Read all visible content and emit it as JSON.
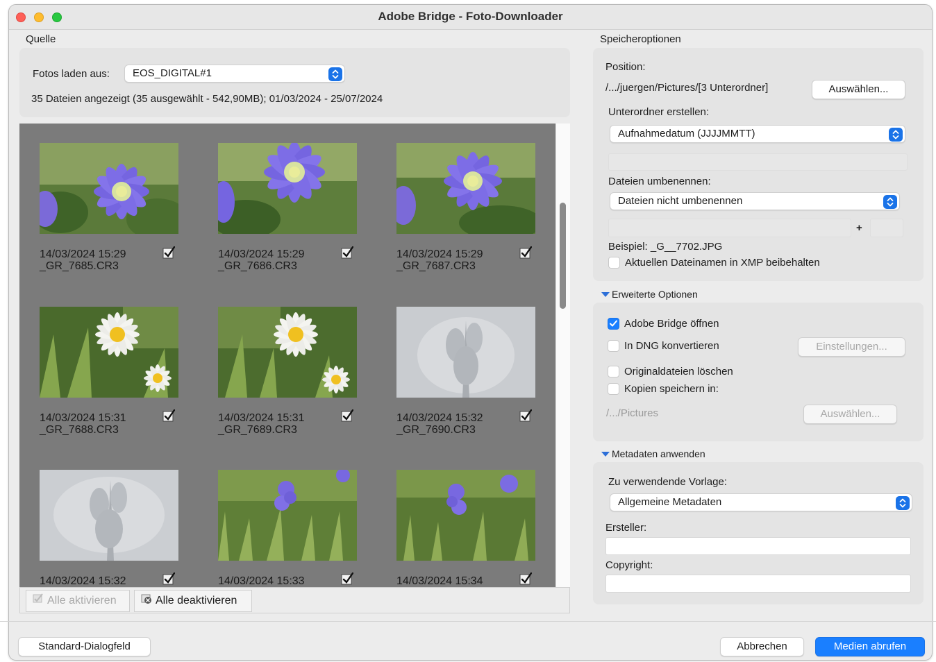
{
  "window": {
    "title": "Adobe Bridge - Foto-Downloader"
  },
  "source": {
    "section_label": "Quelle",
    "load_from_label": "Fotos laden aus:",
    "load_from_value": "EOS_DIGITAL#1",
    "summary": "35 Dateien angezeigt (35 ausgewählt - 542,90MB); 01/03/2024 - 25/07/2024"
  },
  "thumbnails": [
    {
      "date": "14/03/2024 15:29",
      "file": "_GR_7685.CR3",
      "checked": true,
      "kind": "anemone"
    },
    {
      "date": "14/03/2024 15:29",
      "file": "_GR_7686.CR3",
      "checked": true,
      "kind": "anemone"
    },
    {
      "date": "14/03/2024 15:29",
      "file": "_GR_7687.CR3",
      "checked": true,
      "kind": "anemone"
    },
    {
      "date": "14/03/2024 15:31",
      "file": "_GR_7688.CR3",
      "checked": true,
      "kind": "daisy"
    },
    {
      "date": "14/03/2024 15:31",
      "file": "_GR_7689.CR3",
      "checked": true,
      "kind": "daisy"
    },
    {
      "date": "14/03/2024 15:32",
      "file": "_GR_7690.CR3",
      "checked": true,
      "kind": "silver"
    },
    {
      "date": "14/03/2024 15:32",
      "file": "",
      "checked": true,
      "kind": "silver"
    },
    {
      "date": "14/03/2024 15:33",
      "file": "",
      "checked": true,
      "kind": "grass"
    },
    {
      "date": "14/03/2024 15:34",
      "file": "",
      "checked": true,
      "kind": "grass"
    }
  ],
  "grid_toolbar": {
    "activate_all": "Alle aktivieren",
    "deactivate_all": "Alle deaktivieren"
  },
  "save_options": {
    "section_label": "Speicheroptionen",
    "position_label": "Position:",
    "position_value": "/.../juergen/Pictures/[3 Unterordner]",
    "choose_button": "Auswählen...",
    "subfolder_label": "Unterordner erstellen:",
    "subfolder_value": "Aufnahmedatum (JJJJMMTT)",
    "rename_label": "Dateien umbenennen:",
    "rename_value": "Dateien nicht umbenennen",
    "plus": "+",
    "example": "Beispiel: _G__7702.JPG",
    "keep_filename_label": "Aktuellen Dateinamen in XMP beibehalten",
    "keep_filename_checked": false
  },
  "advanced": {
    "section_label": "Erweiterte Optionen",
    "open_bridge_label": "Adobe Bridge öffnen",
    "open_bridge_checked": true,
    "convert_dng_label": "In DNG konvertieren",
    "convert_dng_checked": false,
    "settings_button": "Einstellungen...",
    "delete_originals_label": "Originaldateien löschen",
    "delete_originals_checked": false,
    "save_copies_label": "Kopien speichern in:",
    "save_copies_checked": false,
    "copies_path": "/.../Pictures",
    "copies_choose_button": "Auswählen..."
  },
  "metadata": {
    "section_label": "Metadaten anwenden",
    "template_label": "Zu verwendende Vorlage:",
    "template_value": "Allgemeine Metadaten",
    "creator_label": "Ersteller:",
    "creator_value": "",
    "copyright_label": "Copyright:",
    "copyright_value": ""
  },
  "footer": {
    "standard_dialog": "Standard-Dialogfeld",
    "cancel": "Abbrechen",
    "get_media": "Medien abrufen"
  },
  "colors": {
    "accent": "#1a7fff",
    "grid_bg": "#7b7b7b"
  }
}
